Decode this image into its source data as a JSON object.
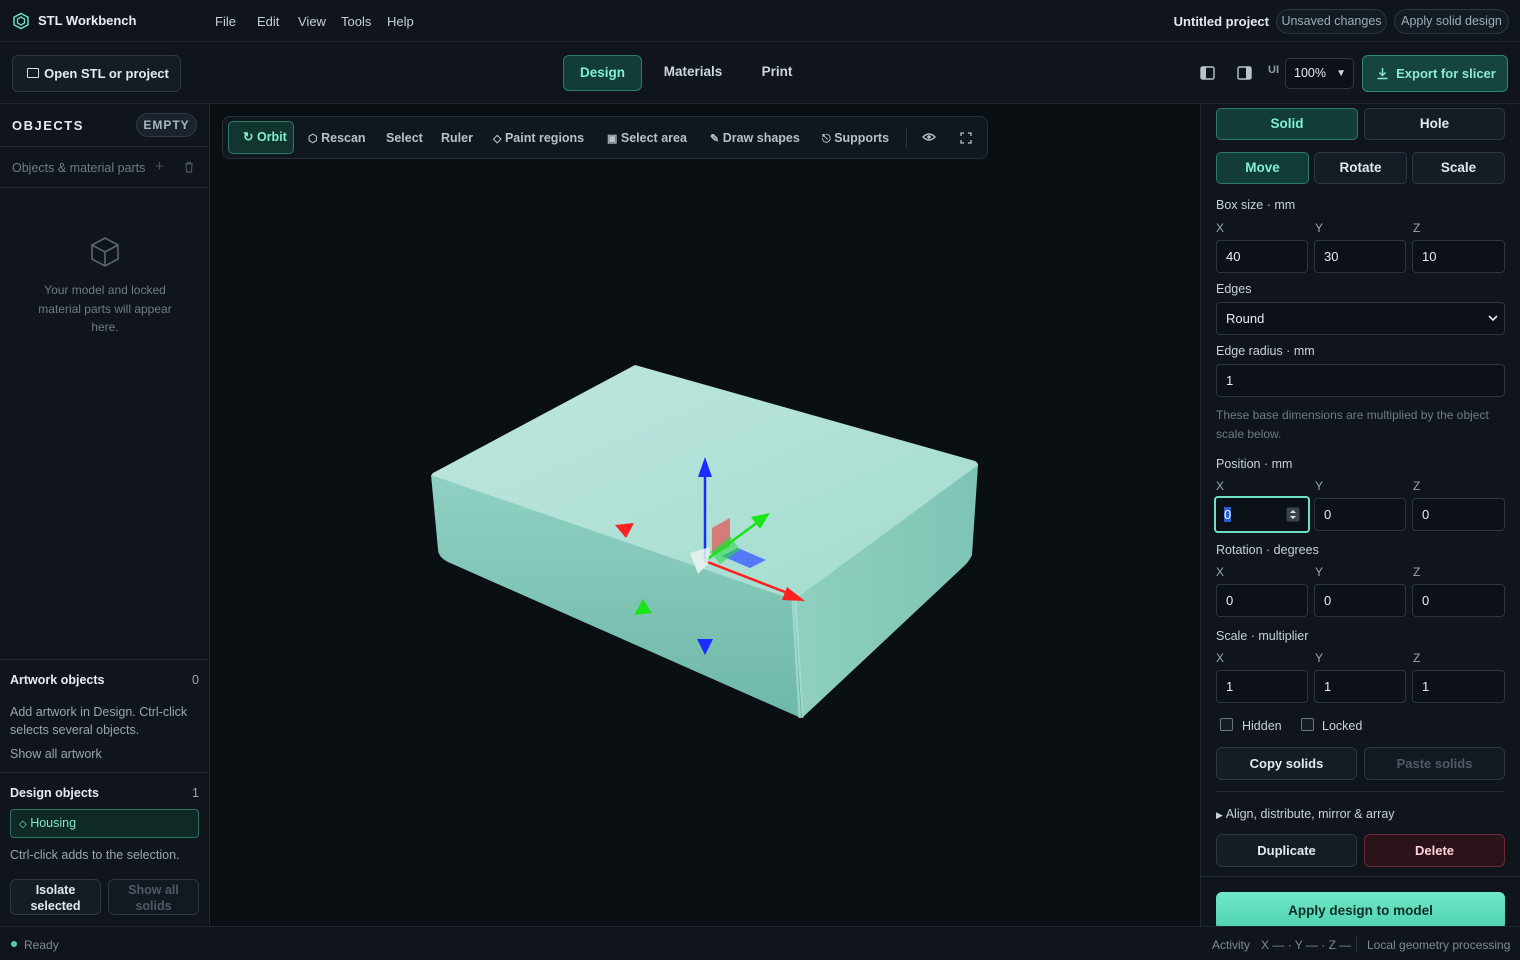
{
  "app": {
    "title": "STL Workbench"
  },
  "menu": [
    "File",
    "Edit",
    "View",
    "Tools",
    "Help"
  ],
  "project": {
    "title": "Untitled project",
    "unsaved": "Unsaved changes",
    "apply_solid": "Apply solid design"
  },
  "toolbar2": {
    "open_label": "Open STL or project",
    "tabs": [
      "Design",
      "Materials",
      "Print"
    ],
    "ui_label": "UI",
    "zoom": "100%",
    "export_label": "Export for slicer"
  },
  "left": {
    "objects_title": "OBJECTS",
    "empty_badge": "EMPTY",
    "parts_label": "Objects & material parts",
    "empty_hint": "Your model and locked material parts will appear here.",
    "artwork_title": "Artwork objects",
    "artwork_count": "0",
    "artwork_hint": "Add artwork in Design. Ctrl-click selects several objects.",
    "show_artwork": "Show all artwork",
    "design_title": "Design objects",
    "design_count": "1",
    "housing": "Housing",
    "ctrl_hint": "Ctrl-click adds to the selection.",
    "isolate": "Isolate selected",
    "show_all": "Show all solids"
  },
  "tools": [
    "Orbit",
    "Rescan",
    "Select",
    "Ruler",
    "Paint regions",
    "Select area",
    "Draw shapes",
    "Supports"
  ],
  "right": {
    "mode": [
      "Solid",
      "Hole"
    ],
    "transform": [
      "Move",
      "Rotate",
      "Scale"
    ],
    "box_label": "Box size · mm",
    "axes": [
      "X",
      "Y",
      "Z"
    ],
    "box": [
      "40",
      "30",
      "10"
    ],
    "edges_label": "Edges",
    "edges_value": "Round",
    "edge_radius_label": "Edge radius · mm",
    "edge_radius": "1",
    "note": "These base dimensions are multiplied by the object scale below.",
    "position_label": "Position · mm",
    "position": [
      "0",
      "0",
      "0"
    ],
    "rotation_label": "Rotation · degrees",
    "rotation": [
      "0",
      "0",
      "0"
    ],
    "scale_label": "Scale · multiplier",
    "scale": [
      "1",
      "1",
      "1"
    ],
    "hidden": "Hidden",
    "locked": "Locked",
    "copy": "Copy solids",
    "paste": "Paste solids",
    "align": "Align, distribute, mirror & array",
    "duplicate": "Duplicate",
    "delete": "Delete",
    "apply": "Apply design to model"
  },
  "status": {
    "ready": "Ready",
    "activity": "Activity",
    "coords": "X — · Y — · Z —",
    "local": "Local geometry processing"
  },
  "colors": {
    "accent": "#4fd1ad",
    "accent_dark": "#123c36",
    "model": "#8fd3c4",
    "axis_x": "#ff2020",
    "axis_y": "#19e619",
    "axis_z": "#1a2cff"
  }
}
